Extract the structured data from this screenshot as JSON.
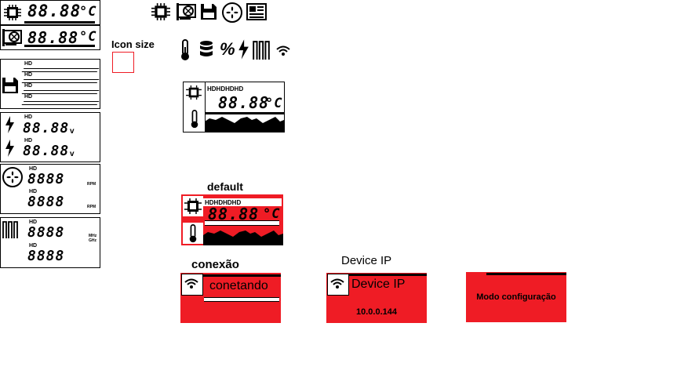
{
  "widgets": {
    "cpu_temp": {
      "value": "88.88",
      "unit": "°C"
    },
    "gpu_temp": {
      "value": "88.88",
      "unit": "°C"
    },
    "disks": {
      "labels": [
        "HD",
        "HD",
        "HD",
        "HD"
      ]
    },
    "voltage": {
      "rows": [
        {
          "label": "HD",
          "value": "88.88",
          "unit": "v"
        },
        {
          "label": "HD",
          "value": "88.88",
          "unit": "v"
        }
      ]
    },
    "fan": {
      "rows": [
        {
          "label": "HD",
          "value": "8888",
          "unit": "RPM"
        },
        {
          "label": "HD",
          "value": "8888",
          "unit": "RPM"
        }
      ]
    },
    "clock": {
      "rows": [
        {
          "label": "HD",
          "value": "8888",
          "unit": "MHz GHz"
        },
        {
          "label": "HD",
          "value": "8888"
        }
      ]
    }
  },
  "icon_size": {
    "label": "Icon size",
    "box_color": "#ef1c25"
  },
  "icons_row1": [
    "cpu-icon",
    "gpu-icon",
    "floppy-disk-icon",
    "fan-icon",
    "motherboard-icon"
  ],
  "icons_row2": [
    "thermometer-icon",
    "database-icon",
    "percent-icon",
    "lightning-icon",
    "memory-icon",
    "wifi-icon"
  ],
  "preview": {
    "hd_labels": "HDHDHDHD",
    "value": "88.88",
    "unit": "°C"
  },
  "default": {
    "title": "default",
    "hd_labels": "HDHDHDHD",
    "value": "88.88",
    "unit": "°C"
  },
  "conexao": {
    "title": "conexão",
    "status": "conetando"
  },
  "device_ip": {
    "title": "Device IP",
    "label": "Device IP",
    "ip": "10.0.0.144"
  },
  "config": {
    "label": "Modo configuração"
  },
  "colors": {
    "accent": "#ef1c25"
  }
}
